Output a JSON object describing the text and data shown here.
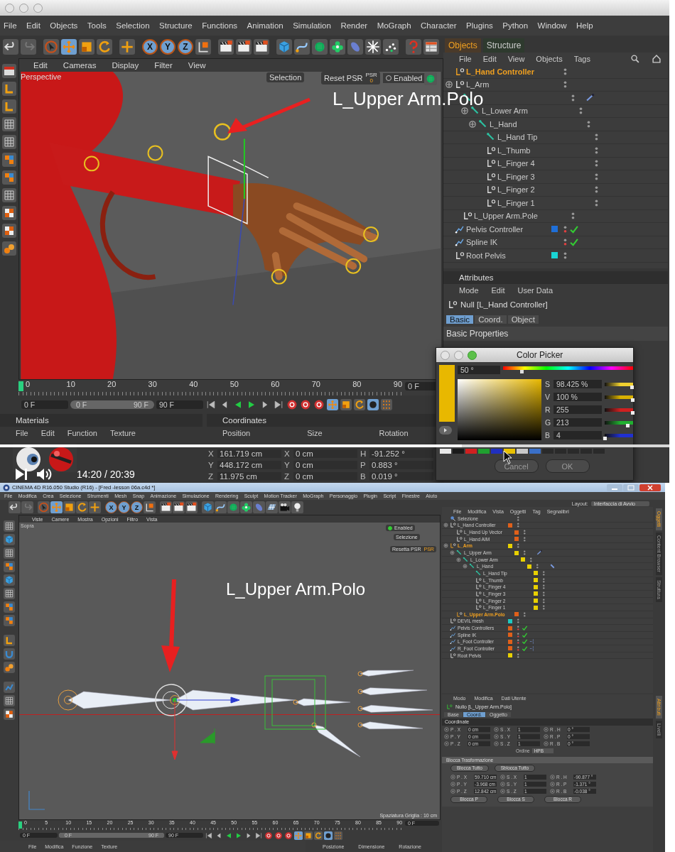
{
  "top": {
    "menu": [
      "File",
      "Edit",
      "Objects",
      "Tools",
      "Selection",
      "Structure",
      "Functions",
      "Animation",
      "Simulation",
      "Render",
      "MoGraph",
      "Character",
      "Plugins",
      "Python",
      "Window",
      "Help"
    ],
    "axes": [
      "X",
      "Y",
      "Z"
    ],
    "viewport": {
      "menu": [
        "Edit",
        "Cameras",
        "Display",
        "Filter",
        "View"
      ],
      "view": "Perspective",
      "selection": "Selection",
      "reset": "Reset PSR",
      "psr": "PSR",
      "psr_value": "0",
      "enabled": {
        "label": "Enabled",
        "checked": false
      }
    },
    "annotation": "L_Upper Arm.Polo",
    "objects": {
      "tabs": [
        {
          "label": "Objects",
          "selected": true
        },
        {
          "label": "Structure",
          "selected": false
        }
      ],
      "menu": [
        "File",
        "Edit",
        "View",
        "Objects",
        "Tags"
      ],
      "items": [
        {
          "label": "L_Hand Controller",
          "kind": "null",
          "selected": true,
          "checked": false
        },
        {
          "label": "L_Arm",
          "kind": "null",
          "selected": false,
          "checked": false,
          "children": [
            {
              "kind": "joint",
              "selected": false,
              "checked": false,
              "tags": [
                {
                  "kind": "bone"
                }
              ],
              "children": [
                {
                  "label": "L_Lower Arm",
                  "kind": "joint",
                  "selected": false,
                  "checked": false,
                  "children": [
                    {
                      "label": "L_Hand",
                      "kind": "joint",
                      "selected": false,
                      "checked": false,
                      "children": [
                        {
                          "label": "L_Hand Tip",
                          "kind": "joint",
                          "selected": false,
                          "checked": false
                        },
                        {
                          "label": "L_Thumb",
                          "kind": "null",
                          "selected": false,
                          "checked": false
                        },
                        {
                          "label": "L_Finger 4",
                          "kind": "null",
                          "selected": false,
                          "checked": false
                        },
                        {
                          "label": "L_Finger 3",
                          "kind": "null",
                          "selected": false,
                          "checked": false
                        },
                        {
                          "label": "L_Finger 2",
                          "kind": "null",
                          "selected": false,
                          "checked": false
                        },
                        {
                          "label": "L_Finger 1",
                          "kind": "null",
                          "selected": false,
                          "checked": false
                        }
                      ]
                    }
                  ]
                }
              ]
            },
            {
              "label": "L_Upper Arm.Pole",
              "kind": "null",
              "selected": false,
              "checked": false
            }
          ]
        },
        {
          "label": "Pelvis Controller",
          "kind": "spline",
          "selected": false,
          "checked": true,
          "color": "#1f6fd8"
        },
        {
          "label": "Spline IK",
          "kind": "spline",
          "selected": false,
          "checked": true
        },
        {
          "label": "Root Pelvis",
          "kind": "null",
          "selected": false,
          "checked": false,
          "color": "#19d4d4"
        }
      ]
    },
    "attributes": {
      "title": "Attributes",
      "menu": [
        "Mode",
        "Edit",
        "User Data"
      ],
      "object": "Null [L_Hand Controller]",
      "tabs": [
        {
          "label": "Basic",
          "selected": true
        },
        {
          "label": "Coord.",
          "selected": false
        },
        {
          "label": "Object",
          "selected": false
        }
      ],
      "section": "Basic Properties"
    },
    "color_picker": {
      "title": "Color Picker",
      "color": "#e8b800",
      "hue": "50 °",
      "hue_slider": {
        "level": 0.14
      },
      "channels": [
        {
          "label": "S",
          "value": "98.425 %",
          "level": 0.984,
          "color": "#f0d030"
        },
        {
          "label": "V",
          "value": "100 %",
          "level": 1,
          "color": "#d8b000"
        },
        {
          "label": "R",
          "value": "255",
          "level": 1,
          "color": "#d02020"
        },
        {
          "label": "G",
          "value": "213",
          "level": 0.835,
          "color": "#20b030"
        },
        {
          "label": "B",
          "value": "4",
          "level": 0.016,
          "color": "#2030d0"
        }
      ],
      "swatches": [
        {
          "color": "#e8e8e8"
        },
        {
          "color": "#1a1a1a"
        },
        {
          "color": "#d02020"
        },
        {
          "color": "#20a030"
        },
        {
          "color": "#2030c0"
        },
        {
          "color": "#e8c000"
        },
        {
          "color": "#c8c8c8"
        },
        {
          "color": "#3a70c8"
        },
        {
          "color": "#2a2a2a"
        },
        {
          "color": "#2a2a2a"
        },
        {
          "color": "#2a2a2a"
        },
        {
          "color": "#2a2a2a"
        },
        {
          "color": "#2a2a2a"
        }
      ],
      "buttons": [
        "Cancel",
        "OK"
      ]
    },
    "timeline": {
      "ticks": [
        "0",
        "10",
        "20",
        "30",
        "40",
        "50",
        "60",
        "70",
        "80",
        "90"
      ],
      "frame": "0 F",
      "start": "0 F",
      "range": {
        "start": "0 F",
        "end": "90 F",
        "level": 1
      },
      "end": "90 F"
    },
    "materials": {
      "title": "Materials",
      "menu": [
        "File",
        "Edit",
        "Function",
        "Texture"
      ]
    },
    "coordinates": {
      "title": "Coordinates",
      "columns": [
        "Position",
        "Size",
        "Rotation"
      ],
      "rows": [
        [
          {
            "label": "X",
            "value": "161.719 cm"
          },
          {
            "label": "X",
            "value": "0 cm"
          },
          {
            "label": "H",
            "value": "-91.252 °"
          }
        ],
        [
          {
            "label": "Y",
            "value": "448.172 cm"
          },
          {
            "label": "Y",
            "value": "0 cm"
          },
          {
            "label": "P",
            "value": "0.883 °"
          }
        ],
        [
          {
            "label": "Z",
            "value": "11.975 cm"
          },
          {
            "label": "Z",
            "value": "0 cm"
          },
          {
            "label": "B",
            "value": "0.019 °"
          }
        ]
      ]
    },
    "player": {
      "time": "14:20  /  20:39",
      "progress": {
        "level": 0.69
      }
    }
  },
  "bottom": {
    "title": "CINEMA 4D R16.050 Studio (R16) - [Fred -lesson 06a.c4d *]",
    "menu": [
      "File",
      "Modifica",
      "Crea",
      "Selezione",
      "Strumenti",
      "Mesh",
      "Snap",
      "Animazione",
      "Simulazione",
      "Rendering",
      "Sculpt",
      "Motion Tracker",
      "MoGraph",
      "Personaggio",
      "Plugin",
      "Script",
      "Finestre",
      "Aiuto"
    ],
    "layout": {
      "label": "Layout:",
      "value": "Interfaccia di Avvio"
    },
    "axes": [
      "X",
      "Y",
      "Z"
    ],
    "viewport": {
      "menu": [
        "Viste",
        "Camere",
        "Mostra",
        "Opzioni",
        "Filtro",
        "Vista"
      ],
      "view": "Sopra",
      "enabled": {
        "label": "Enabled",
        "checked": true
      },
      "selection": "Selezione",
      "reset": "Resetta PSR",
      "psr": "PSR",
      "grid": "Spaziatura Griglia : 10 cm"
    },
    "annotation": "L_Upper Arm.Polo",
    "objects": {
      "menu": [
        "File",
        "Modifica",
        "Vista",
        "Oggetti",
        "Tag",
        "Segnalibri"
      ],
      "side_tabs": [
        {
          "label": "Oggetti",
          "selected": true
        },
        {
          "label": "Content Browser",
          "selected": false
        },
        {
          "label": "Struttura",
          "selected": false
        }
      ],
      "items": [
        {
          "label": "Selezione",
          "kind": "selection",
          "selected": false,
          "checked": false
        },
        {
          "label": "L_Hand Controller",
          "kind": "null",
          "selected": false,
          "checked": false,
          "color": "#e0601a",
          "children": [
            {
              "label": "L_Hand Up Vector",
              "kind": "null",
              "selected": false,
              "checked": false,
              "color": "#e0601a"
            },
            {
              "label": "L_Hand AIM",
              "kind": "null",
              "selected": false,
              "checked": false,
              "color": "#e0601a"
            }
          ]
        },
        {
          "label": "L_Arm",
          "kind": "null",
          "selected": true,
          "checked": false,
          "color": "#e8d000",
          "children": [
            {
              "label": "L_Upper Arm",
              "kind": "joint",
              "selected": false,
              "checked": false,
              "color": "#e8d000",
              "tags": [
                {
                  "kind": "bone"
                }
              ],
              "children": [
                {
                  "label": "L_Lower Arm",
                  "kind": "joint",
                  "selected": false,
                  "checked": false,
                  "color": "#e8d000",
                  "children": [
                    {
                      "label": "L_Hand",
                      "kind": "joint",
                      "selected": false,
                      "checked": false,
                      "color": "#e8d000",
                      "tags": [
                        {
                          "kind": "pin"
                        }
                      ],
                      "children": [
                        {
                          "label": "L_Hand Tip",
                          "kind": "joint",
                          "selected": false,
                          "checked": false,
                          "color": "#e8d000"
                        },
                        {
                          "label": "L_Thumb",
                          "kind": "null",
                          "selected": false,
                          "checked": false,
                          "color": "#e8d000"
                        },
                        {
                          "label": "L_Finger 4",
                          "kind": "null",
                          "selected": false,
                          "checked": false,
                          "color": "#e8d000"
                        },
                        {
                          "label": "L_Finger 3",
                          "kind": "null",
                          "selected": false,
                          "checked": false,
                          "color": "#e8d000"
                        },
                        {
                          "label": "L_Finger 2",
                          "kind": "null",
                          "selected": false,
                          "checked": false,
                          "color": "#e8d000"
                        },
                        {
                          "label": "L_Finger 1",
                          "kind": "null",
                          "selected": false,
                          "checked": false,
                          "color": "#e8d000"
                        }
                      ]
                    }
                  ]
                }
              ]
            },
            {
              "label": "L_Upper Arm.Polo",
              "kind": "null",
              "selected": true,
              "checked": false,
              "color": "#e0601a"
            }
          ]
        },
        {
          "label": "DEVIL mesh",
          "kind": "null",
          "selected": false,
          "checked": false,
          "color": "#1fc8c0"
        },
        {
          "label": "Pelvis  Controllers",
          "kind": "spline",
          "selected": false,
          "checked": true,
          "color": "#e0601a"
        },
        {
          "label": "Spline IK",
          "kind": "spline",
          "selected": false,
          "checked": true,
          "color": "#e0601a"
        },
        {
          "label": "L_Foot Controller",
          "kind": "spline",
          "selected": false,
          "checked": true,
          "color": "#e0601a",
          "tags": [
            {
              "kind": "points"
            }
          ]
        },
        {
          "label": "R_Foot Controller",
          "kind": "spline",
          "selected": false,
          "checked": true,
          "color": "#e0601a",
          "tags": [
            {
              "kind": "points"
            }
          ]
        },
        {
          "label": "Root Pelvis",
          "kind": "null",
          "selected": false,
          "checked": false,
          "color": "#e8d000"
        }
      ]
    },
    "attributes": {
      "menu": [
        "Modo",
        "Modifica",
        "Dati Utente"
      ],
      "object": "Nullo [L_Upper Arm.Polo]",
      "tabs": [
        {
          "label": "Base",
          "selected": false
        },
        {
          "label": "Coord.",
          "selected": true
        },
        {
          "label": "Oggetto",
          "selected": false
        }
      ],
      "side_tabs": [
        {
          "label": "Attributi",
          "selected": true
        },
        {
          "label": "Livelli",
          "selected": false
        }
      ],
      "section": "Coordinate",
      "rows": [
        [
          {
            "label": "P . X",
            "value": "0 cm"
          },
          {
            "label": "S . X",
            "value": "1"
          },
          {
            "label": "R . H",
            "value": "0 °"
          }
        ],
        [
          {
            "label": "P . Y",
            "value": "0 cm"
          },
          {
            "label": "S . Y",
            "value": "1"
          },
          {
            "label": "R . P",
            "value": "0 °"
          }
        ],
        [
          {
            "label": "P . Z",
            "value": "0 cm"
          },
          {
            "label": "S . Z",
            "value": "1"
          },
          {
            "label": "R . B",
            "value": "0 °"
          }
        ]
      ],
      "order": {
        "label": "Ordine",
        "value": "HPB"
      },
      "group": "Blocca Trasformazione",
      "group_buttons": [
        "Blocca Tutto",
        "Sblocca Tutto"
      ],
      "freeze_rows": [
        [
          {
            "label": "P . X",
            "value": "59.710 cm"
          },
          {
            "label": "S . X",
            "value": "1"
          },
          {
            "label": "R . H",
            "value": "-90.877 °"
          }
        ],
        [
          {
            "label": "P . Y",
            "value": "-3.968 cm"
          },
          {
            "label": "S . Y",
            "value": "1"
          },
          {
            "label": "R . P",
            "value": "-1.371 °"
          }
        ],
        [
          {
            "label": "P . Z",
            "value": "12.842 cm"
          },
          {
            "label": "S . Z",
            "value": "1"
          },
          {
            "label": "R . B",
            "value": "-0.038 °"
          }
        ]
      ],
      "freeze_buttons": [
        "Blocca P",
        "Blocca S",
        "Blocca R"
      ]
    },
    "timeline": {
      "ticks": [
        "0",
        "5",
        "10",
        "15",
        "20",
        "25",
        "30",
        "35",
        "40",
        "45",
        "50",
        "55",
        "60",
        "65",
        "70",
        "75",
        "80",
        "85",
        "90"
      ],
      "frame": "0 F",
      "start": "0 F",
      "range": {
        "start": "0 F",
        "end": "90 F",
        "level": 1
      },
      "end": "90 F"
    },
    "materials": {
      "menu": [
        "File",
        "Modifica",
        "Funzione",
        "Texture"
      ]
    },
    "coordinates": {
      "columns": [
        "Posizione",
        "Dimensione",
        "Rotazione"
      ]
    }
  }
}
